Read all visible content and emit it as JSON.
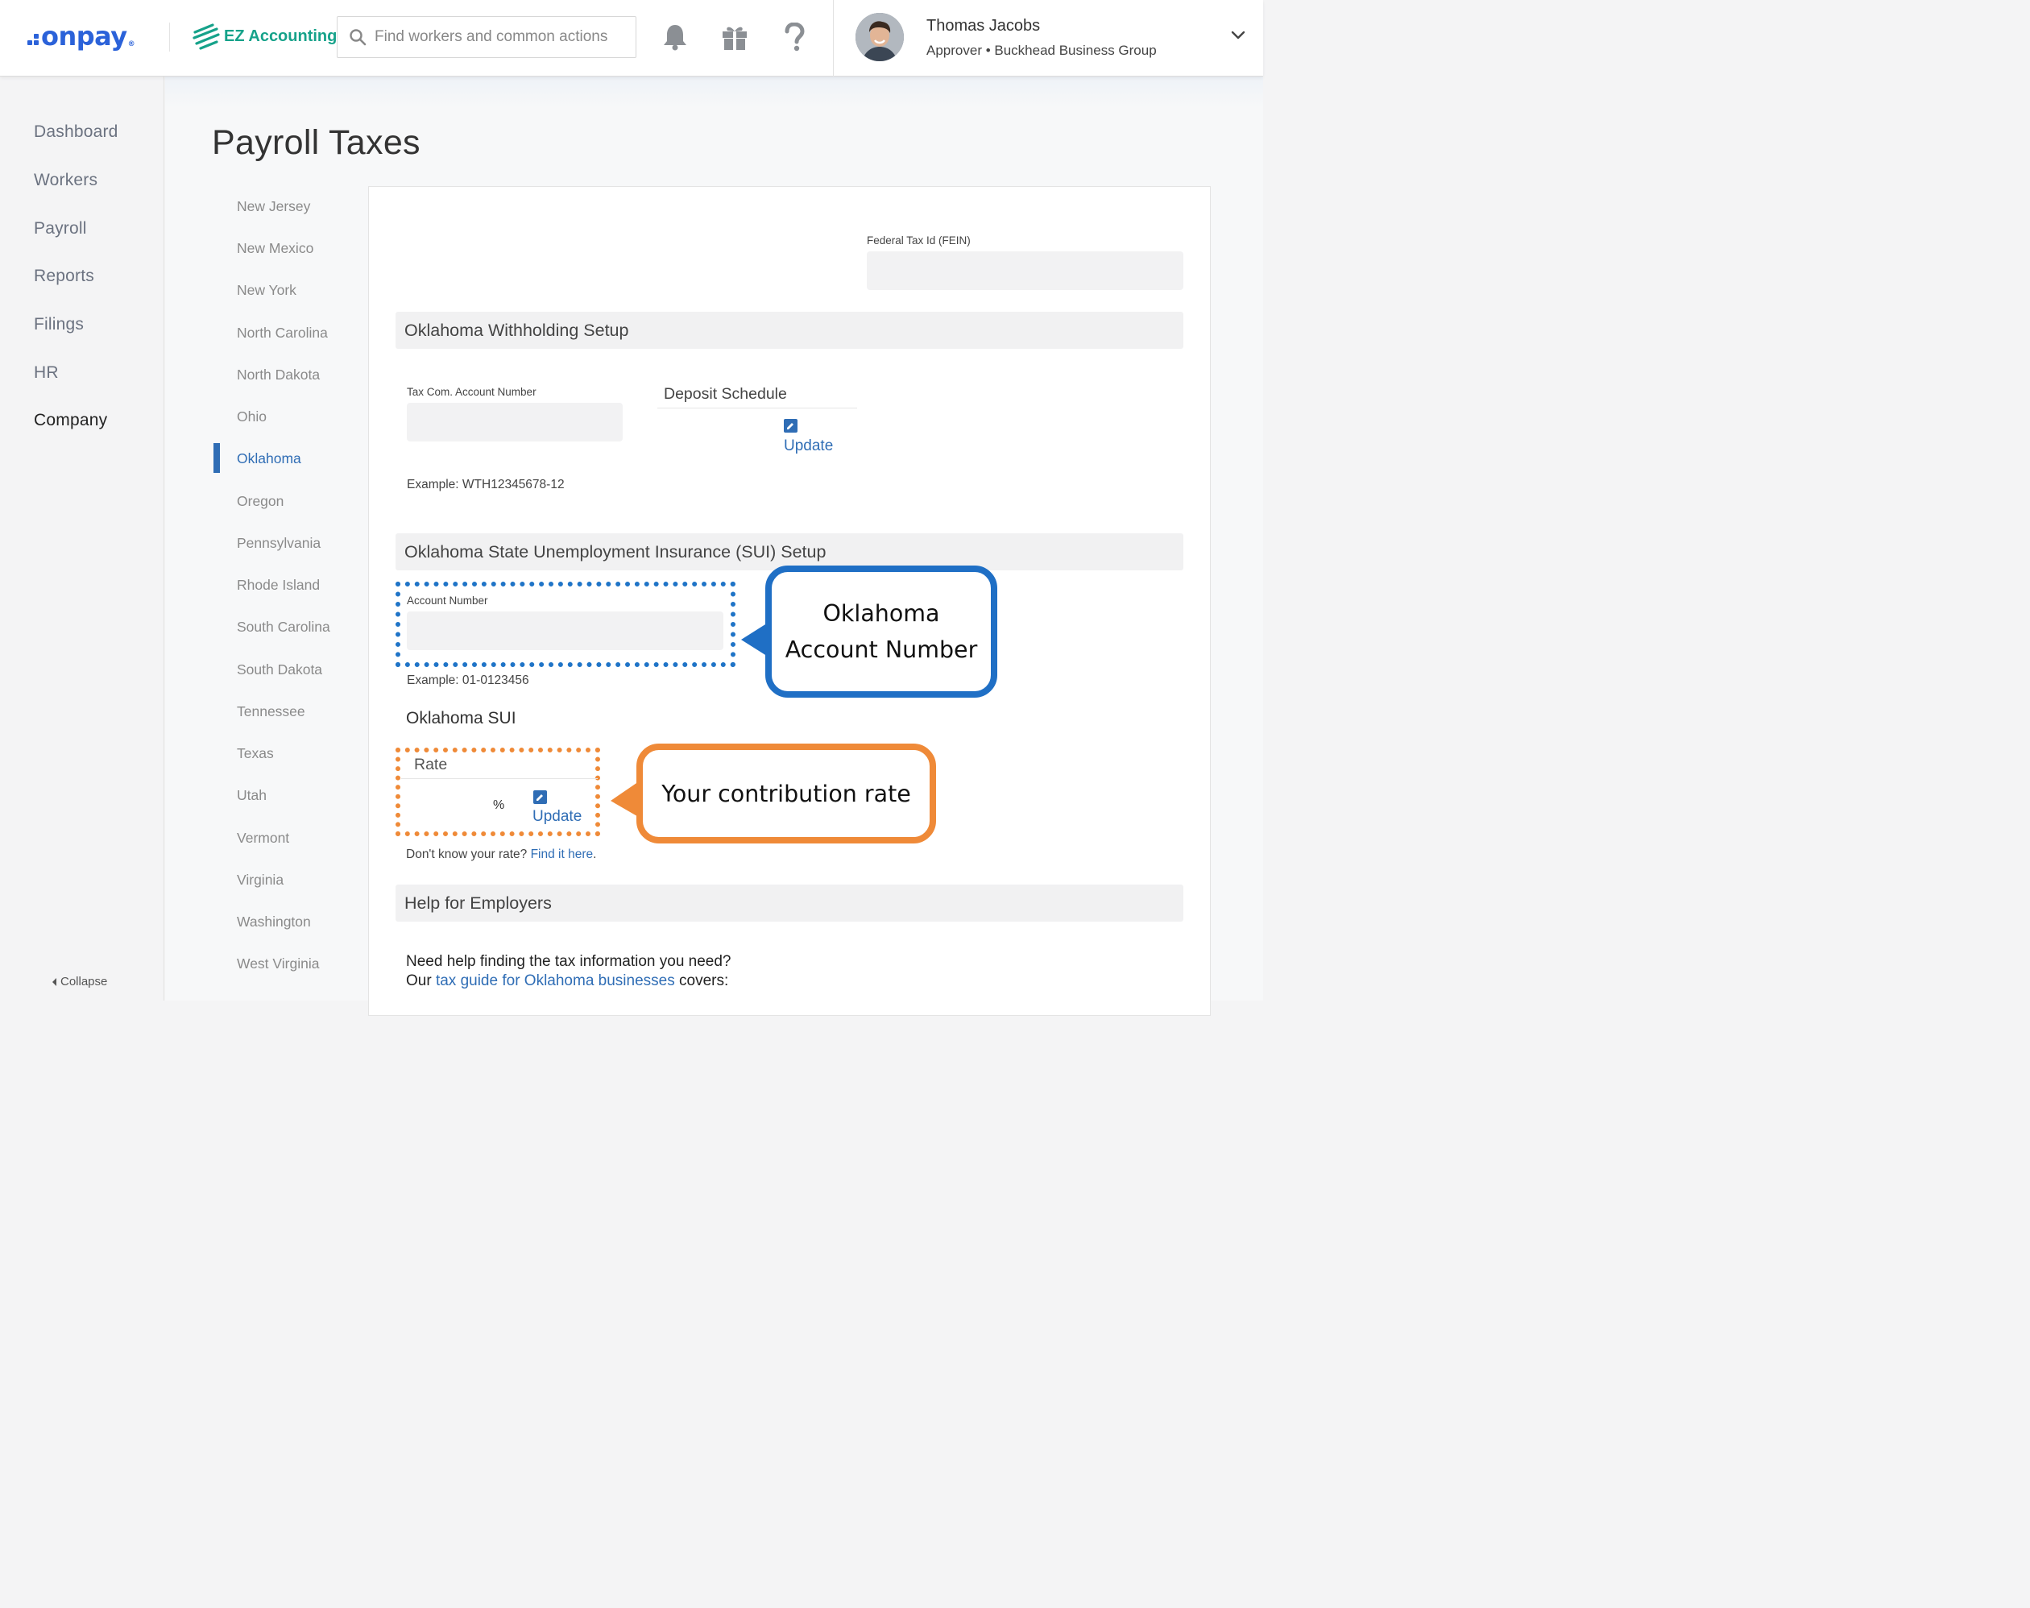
{
  "header": {
    "logo_text": "onpay",
    "logo_reg": "®",
    "partner_name": "EZ Accounting",
    "search_placeholder": "Find workers and common actions",
    "icons": [
      "bell-icon",
      "gift-icon",
      "help-icon"
    ],
    "user": {
      "name": "Thomas Jacobs",
      "role": "Approver • Buckhead Business Group"
    }
  },
  "sidebar": {
    "items": [
      {
        "label": "Dashboard"
      },
      {
        "label": "Workers"
      },
      {
        "label": "Payroll"
      },
      {
        "label": "Reports"
      },
      {
        "label": "Filings"
      },
      {
        "label": "HR"
      },
      {
        "label": "Company",
        "active": true
      }
    ],
    "collapse_label": "Collapse"
  },
  "page": {
    "title": "Payroll Taxes"
  },
  "states": [
    {
      "label": "New Jersey"
    },
    {
      "label": "New Mexico"
    },
    {
      "label": "New York"
    },
    {
      "label": "North Carolina"
    },
    {
      "label": "North Dakota"
    },
    {
      "label": "Ohio"
    },
    {
      "label": "Oklahoma",
      "active": true
    },
    {
      "label": "Oregon"
    },
    {
      "label": "Pennsylvania"
    },
    {
      "label": "Rhode Island"
    },
    {
      "label": "South Carolina"
    },
    {
      "label": "South Dakota"
    },
    {
      "label": "Tennessee"
    },
    {
      "label": "Texas"
    },
    {
      "label": "Utah"
    },
    {
      "label": "Vermont"
    },
    {
      "label": "Virginia"
    },
    {
      "label": "Washington"
    },
    {
      "label": "West Virginia"
    }
  ],
  "form": {
    "fein_label": "Federal Tax Id (FEIN)",
    "fein_value": "",
    "withholding_title": "Oklahoma Withholding Setup",
    "tax_com_label": "Tax Com. Account Number",
    "tax_com_value": "",
    "deposit_schedule_label": "Deposit Schedule",
    "update_label": "Update",
    "withholding_example": "Example: WTH12345678-12",
    "sui_section_title": "Oklahoma State Unemployment Insurance (SUI) Setup",
    "account_number_label": "Account Number",
    "account_number_value": "",
    "account_example": "Example: 01-0123456",
    "sui_title": "Oklahoma SUI",
    "rate_label": "Rate",
    "rate_unit": "%",
    "dont_know_text": "Don't know your rate? ",
    "find_it_link": "Find it here",
    "dont_know_end": ".",
    "help_title": "Help for Employers",
    "help_line1": "Need help finding the tax information you need?",
    "help_line2_prefix": "Our ",
    "help_link": "tax guide for Oklahoma businesses",
    "help_line2_suffix": " covers:"
  },
  "callouts": {
    "account_line1": "Oklahoma",
    "account_line2": "Account Number",
    "rate": "Your contribution rate"
  },
  "colors": {
    "brand_blue": "#2b62d9",
    "link_blue": "#2f6db5",
    "ez_green": "#16a28a",
    "callout_blue": "#1f6fc5",
    "callout_orange": "#ef8a38"
  }
}
